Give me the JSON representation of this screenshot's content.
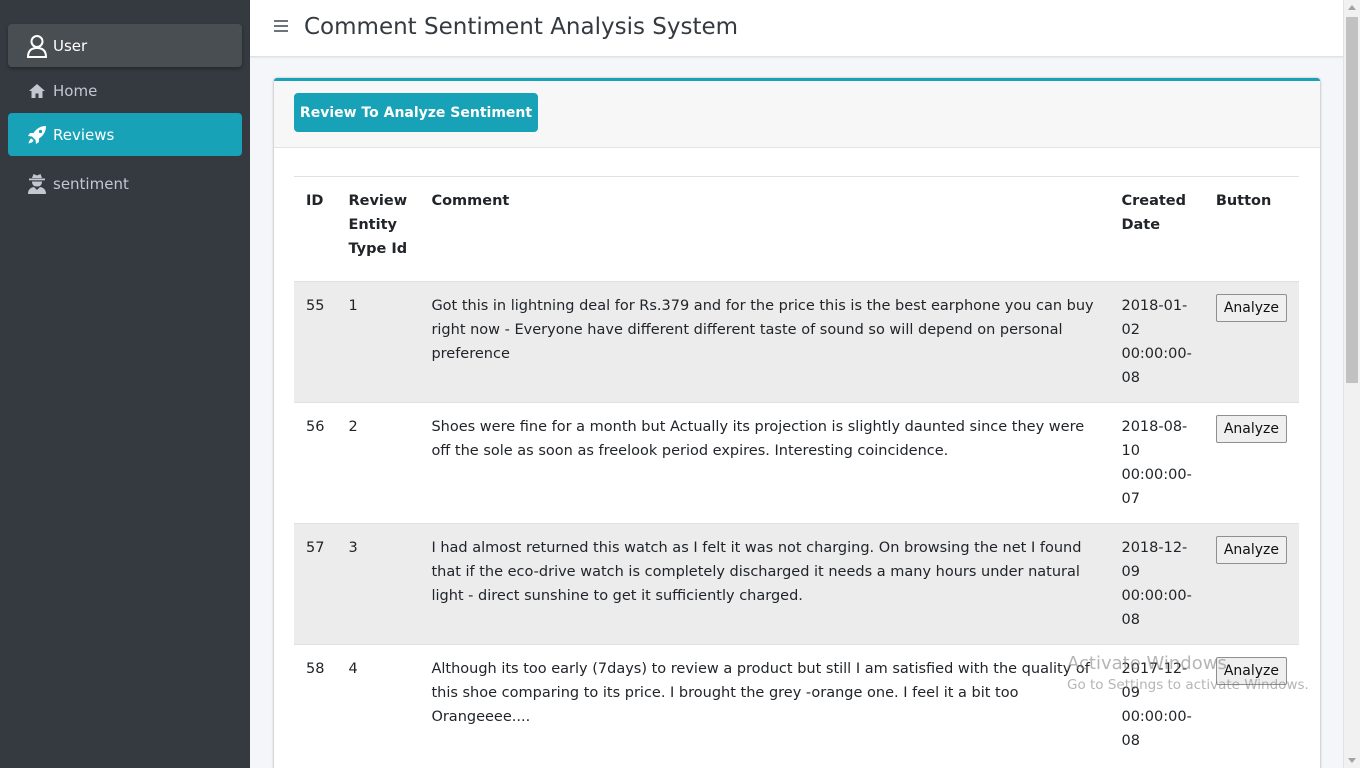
{
  "app": {
    "title": "Comment Sentiment Analysis System"
  },
  "sidebar": {
    "items": [
      {
        "label": "User",
        "icon": "user-icon"
      },
      {
        "label": "Home",
        "icon": "home-icon"
      },
      {
        "label": "Reviews",
        "icon": "rocket-icon",
        "active": true
      },
      {
        "label": "sentiment",
        "icon": "user-secret-icon"
      }
    ]
  },
  "card": {
    "button_label": "Review To Analyze Sentiment"
  },
  "table": {
    "headers": {
      "id": "ID",
      "type": "Review Entity Type Id",
      "comment": "Comment",
      "date": "Created Date",
      "button": "Button"
    },
    "rows": [
      {
        "id": "55",
        "type": "1",
        "comment": "Got this in lightning deal for Rs.379 and for the price this is the best earphone you can buy right now - Everyone have different different taste of sound so will depend on personal preference",
        "date": "2018-01-02 00:00:00-08",
        "action": "Analyze"
      },
      {
        "id": "56",
        "type": "2",
        "comment": "Shoes were fine for a month but Actually its projection is slightly daunted since they were off the sole as soon as freelook period expires. Interesting coincidence.",
        "date": "2018-08-10 00:00:00-07",
        "action": "Analyze"
      },
      {
        "id": "57",
        "type": "3",
        "comment": "I had almost returned this watch as I felt it was not charging. On browsing the net I found that if the eco-drive watch is completely discharged it needs a many hours under natural light - direct sunshine to get it sufficiently charged.",
        "date": "2018-12-09 00:00:00-08",
        "action": "Analyze"
      },
      {
        "id": "58",
        "type": "4",
        "comment": "Although its too early (7days) to review a product but still I am satisfied with the quality of this shoe comparing to its price. I brought the grey -orange one. I feel it a bit too Orangeeee....",
        "date": "2017-12-09 00:00:00-08",
        "action": "Analyze"
      }
    ]
  },
  "watermark": {
    "line1": "Activate Windows",
    "line2": "Go to Settings to activate Windows."
  },
  "colors": {
    "accent": "#17a2b8",
    "sidebar": "#343a40"
  }
}
